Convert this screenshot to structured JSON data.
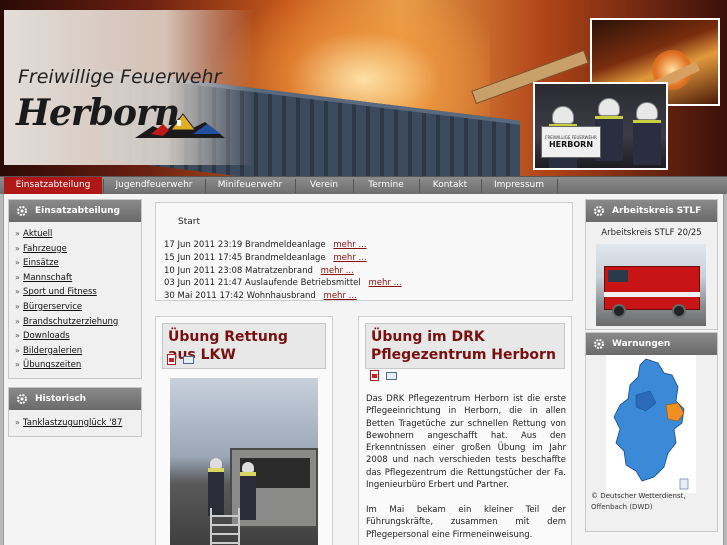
{
  "header": {
    "logo_line1": "Freiwillige Feuerwehr",
    "logo_line2": "Herborn",
    "sign_line1": "FREIWILLIGE FEUERWEHR",
    "sign_line2": "HERBORN"
  },
  "nav": {
    "items": [
      "Einsatzabteilung",
      "Jugendfeuerwehr",
      "Minifeuerwehr",
      "Verein",
      "Termine",
      "Kontakt",
      "Impressum"
    ],
    "active_index": 0
  },
  "sidebar": {
    "einsatz_title": "Einsatzabteilung",
    "einsatz_items": [
      "Aktuell",
      "Fahrzeuge",
      "Einsätze",
      "Mannschaft",
      "Sport und Fitness",
      "Bürgerservice",
      "Brandschutzerziehung",
      "Downloads",
      "Bildergalerien",
      "Übungszeiten"
    ],
    "historisch_title": "Historisch",
    "historisch_items": [
      "Tanklastzugunglück '87"
    ]
  },
  "news": {
    "start": "Start",
    "more": "mehr ...",
    "rows": [
      {
        "date": "17 Jun 2011 23:19",
        "title": "Brandmeldeanlage"
      },
      {
        "date": "15 Jun 2011 17:45",
        "title": "Brandmeldeanlage"
      },
      {
        "date": "10 Jun 2011 23:08",
        "title": "Matratzenbrand"
      },
      {
        "date": "03 Jun 2011 21:47",
        "title": "Auslaufende Betriebsmittel"
      },
      {
        "date": "30 Mai 2011 17:42",
        "title": "Wohnhausbrand"
      }
    ]
  },
  "articles": {
    "lkw_title": "Übung Rettung aus LKW",
    "drk_title": "Übung im DRK Pflegezentrum Herborn",
    "drk_para1": "Das DRK Pflegezentrum Herborn ist die erste Pflegeeinrichtung in Herborn, die in allen Betten Tragetüche zur schnellen Rettung von Bewohnern angeschafft hat. Aus den Erkenntnissen einer großen Übung im Jahr 2008 und nach verschieden tests beschaffte das Pflegezentrum die Rettungstücher der Fa. Ingenieurbüro Erbert und Partner.",
    "drk_para2": "Im Mai bekam ein kleiner Teil der Führungskräfte, zusammen mit dem Pflegepersonal eine Firmeneinweisung."
  },
  "right": {
    "stlf_title": "Arbeitskreis STLF 20/25",
    "stlf_caption": "Arbeitskreis STLF 20/25",
    "warn_title": "Warnungen",
    "dwd_line1": "© Deutscher Wetterdienst,",
    "dwd_line2": "Offenbach (DWD)"
  },
  "colors": {
    "accent": "#b01818",
    "title_red": "#7a0e0e",
    "map_blue": "#3a8ad8",
    "map_orange": "#f09020"
  }
}
